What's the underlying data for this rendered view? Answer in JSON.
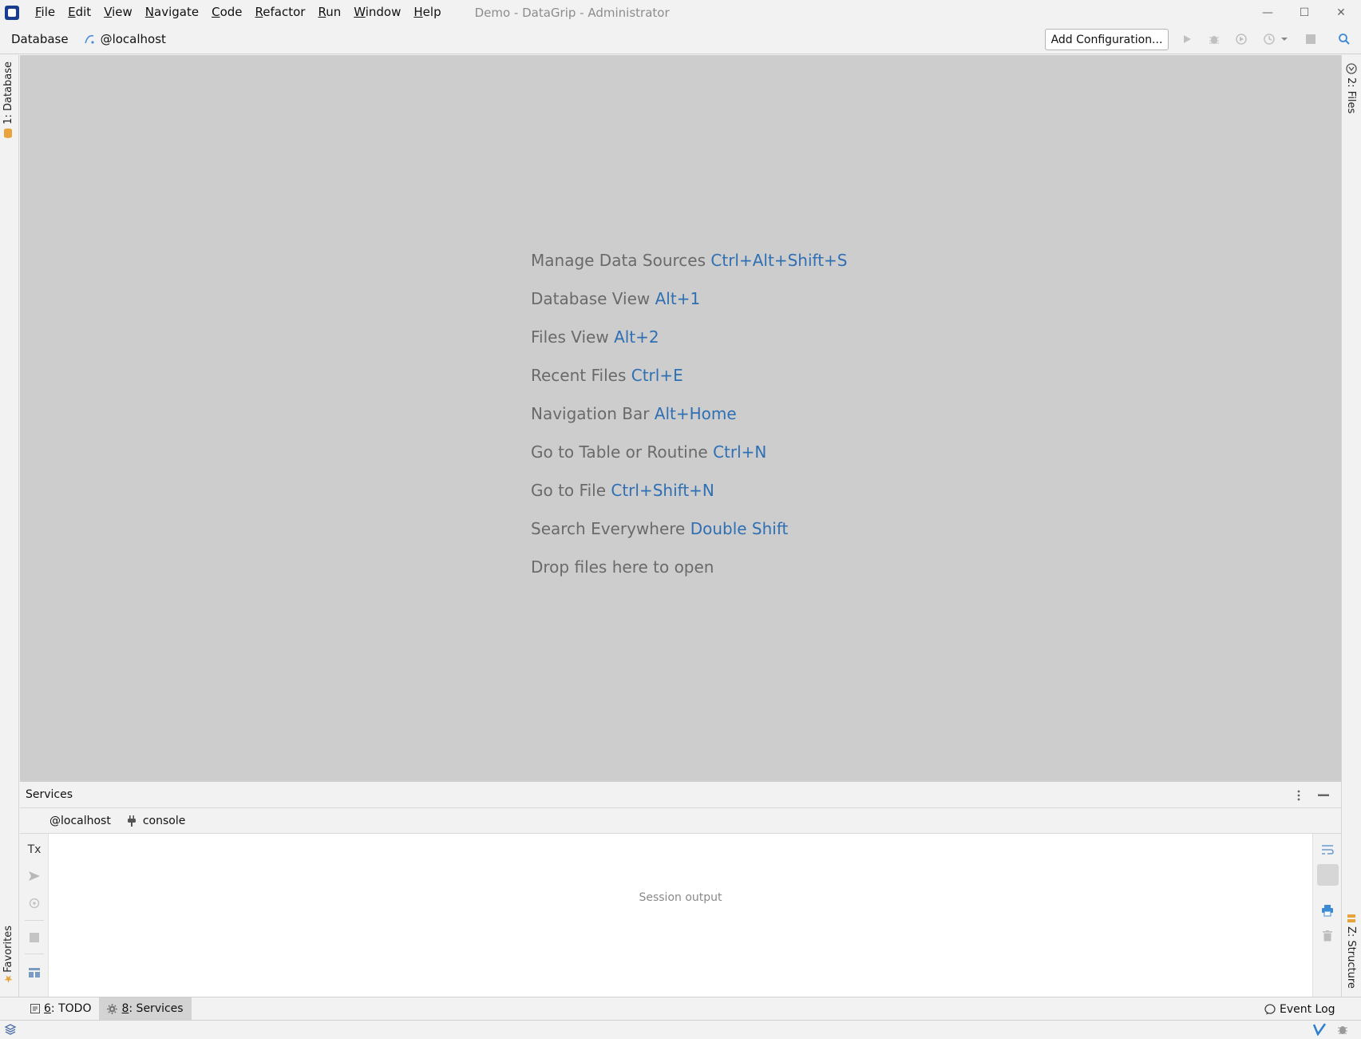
{
  "app": {
    "window_title": "Demo - DataGrip - Administrator",
    "logo_icon": "datagrip-logo-icon"
  },
  "menu": [
    {
      "mnemonic": "F",
      "rest": "ile"
    },
    {
      "mnemonic": "E",
      "rest": "dit"
    },
    {
      "mnemonic": "V",
      "rest": "iew"
    },
    {
      "mnemonic": "N",
      "rest": "avigate"
    },
    {
      "mnemonic": "C",
      "rest": "ode"
    },
    {
      "mnemonic": "R",
      "rest": "efactor"
    },
    {
      "mnemonic": "R",
      "rest": "un"
    },
    {
      "mnemonic": "W",
      "rest": "indow"
    },
    {
      "mnemonic": "H",
      "rest": "elp"
    }
  ],
  "window_controls": {
    "minimize": "—",
    "maximize": "☐",
    "close": "✕"
  },
  "navbar": {
    "breadcrumb_root": "Database",
    "breadcrumb_host": "@localhost",
    "add_configuration": "Add Configuration..."
  },
  "tool_windows": {
    "left_top": "1: Database",
    "left_bottom": "Favorites",
    "right_top": "2: Files",
    "right_bottom": "Z: Structure"
  },
  "editor_hints": [
    {
      "label": "Manage Data Sources ",
      "key": "Ctrl+Alt+Shift+S"
    },
    {
      "label": "Database View ",
      "key": "Alt+1"
    },
    {
      "label": "Files View ",
      "key": "Alt+2"
    },
    {
      "label": "Recent Files ",
      "key": "Ctrl+E"
    },
    {
      "label": "Navigation Bar ",
      "key": "Alt+Home"
    },
    {
      "label": "Go to Table or Routine ",
      "key": "Ctrl+N"
    },
    {
      "label": "Go to File ",
      "key": "Ctrl+Shift+N"
    },
    {
      "label": "Search Everywhere ",
      "key": "Double Shift"
    },
    {
      "label": "Drop files here to open",
      "key": ""
    }
  ],
  "services": {
    "title": "Services",
    "tab_host": "@localhost",
    "tab_console": "console",
    "tx_label": "Tx",
    "session_output": "Session output"
  },
  "bottom_tabs": {
    "todo_num": "6",
    "todo_label": ": TODO",
    "services_num": "8",
    "services_label": ": Services",
    "event_log": "Event Log"
  },
  "colors": {
    "editor_bg": "#cdcdcd",
    "shortcut_blue": "#2f6fb3",
    "hint_gray": "#6a6a6a"
  }
}
